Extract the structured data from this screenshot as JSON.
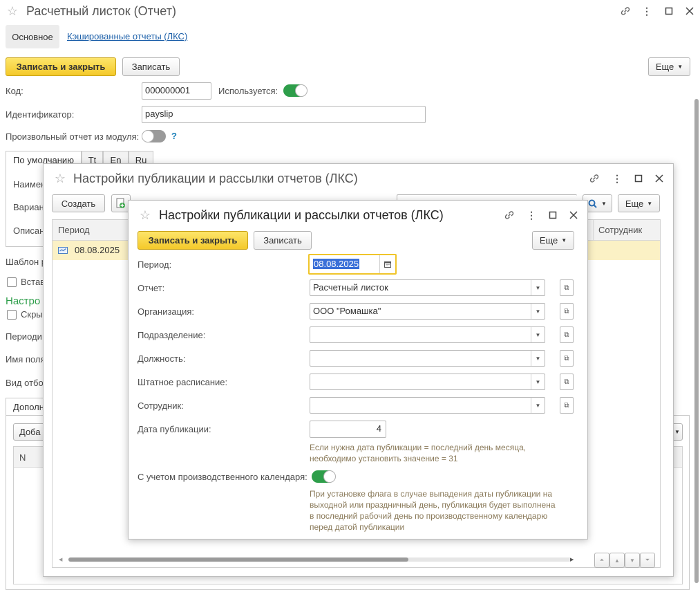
{
  "main_window": {
    "title": "Расчетный листок (Отчет)",
    "tabs": [
      "Основное",
      "Кэшированные отчеты (ЛКС)"
    ],
    "toolbar": {
      "save_close": "Записать и закрыть",
      "save": "Записать",
      "more": "Еще"
    },
    "fields": {
      "code_label": "Код:",
      "code_value": "000000001",
      "used_label": "Используется:",
      "identifier_label": "Идентификатор:",
      "identifier_value": "payslip",
      "custom_report_label": "Произвольный отчет из модуля:",
      "help": "?"
    },
    "lang_tabs": [
      "По умолчанию",
      "Tt",
      "En",
      "Ru"
    ],
    "clipped_labels": [
      "Наимен",
      "Вариан",
      "Описан",
      "Шаблон р",
      "Встав",
      "Настро",
      "Скры",
      "Периоди",
      "Имя поля",
      "Вид отбо",
      "Дополн",
      "Доба",
      "N"
    ]
  },
  "list_window": {
    "title": "Настройки публикации и рассылки отчетов (ЛКС)",
    "toolbar": {
      "create": "Создать",
      "more": "Еще"
    },
    "columns": [
      "Период",
      "Сотрудник"
    ],
    "rows": [
      {
        "period": "08.08.2025"
      }
    ]
  },
  "dialog": {
    "title": "Настройки публикации и рассылки отчетов (ЛКС)",
    "toolbar": {
      "save_close": "Записать и закрыть",
      "save": "Записать",
      "more": "Еще"
    },
    "fields": [
      {
        "label": "Период:",
        "value": "08.08.2025"
      },
      {
        "label": "Отчет:",
        "value": "Расчетный листок"
      },
      {
        "label": "Организация:",
        "value": "ООО \"Ромашка\""
      },
      {
        "label": "Подразделение:",
        "value": ""
      },
      {
        "label": "Должность:",
        "value": ""
      },
      {
        "label": "Штатное расписание:",
        "value": ""
      },
      {
        "label": "Сотрудник:",
        "value": ""
      },
      {
        "label": "Дата публикации:",
        "value": "4"
      }
    ],
    "hint_date_line1": "Если нужна дата публикации = последний день месяца,",
    "hint_date_line2": "необходимо установить значение = 31",
    "calendar_label": "С учетом производственного календаря:",
    "calendar_hint": [
      "При установке флага в случае выпадения даты публикации на",
      "выходной или праздничный день, публикация будет выполнена",
      "в последний рабочий день по производственному календарю",
      "перед датой публикации"
    ]
  },
  "colors": {
    "accent_yellow": "#f4c92a",
    "toggle_on": "#2e9e4a",
    "link": "#1a5ea8",
    "hint": "#8a7a5a"
  }
}
